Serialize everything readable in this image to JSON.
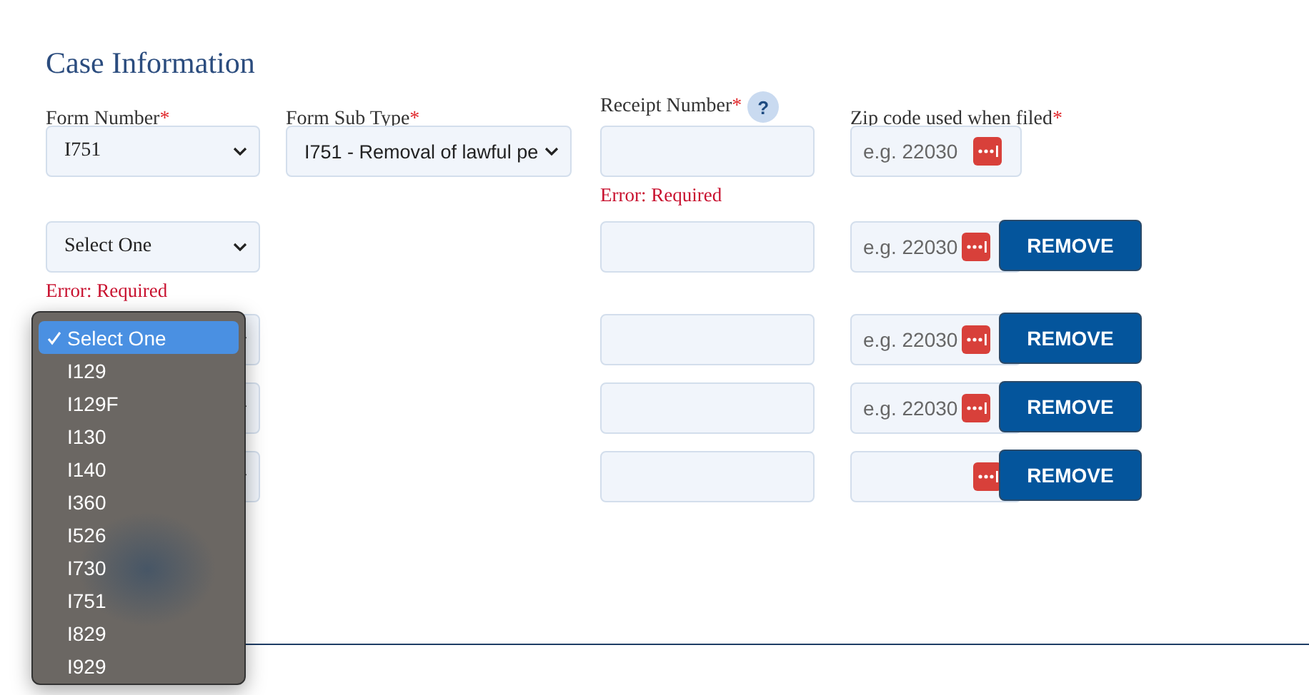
{
  "section_title": "Case Information",
  "columns": [
    {
      "label": "Form Number",
      "mark": "*"
    },
    {
      "label": "Form Sub Type",
      "mark": "*"
    },
    {
      "label": "Receipt Number",
      "mark": "*",
      "help": "?"
    },
    {
      "label": "Zip code used when filed",
      "mark": "*"
    }
  ],
  "rows": [
    {
      "form_number": {
        "value": "I751"
      },
      "sub_type": {
        "value": "I751 - Removal of lawful pe"
      },
      "receipt": {
        "error": "Error: Required"
      },
      "zip": {
        "placeholder": "e.g. 22030"
      }
    },
    {
      "form_number": {
        "value": "Select One",
        "error": "Error: Required"
      },
      "receipt": {},
      "zip": {
        "placeholder": "e.g. 22030"
      },
      "remove": "REMOVE"
    },
    {
      "form_number": {},
      "receipt": {},
      "zip": {
        "placeholder": "e.g. 22030"
      },
      "remove": "REMOVE"
    },
    {
      "form_number": {},
      "receipt": {},
      "zip": {
        "placeholder": "e.g. 22030"
      },
      "remove": "REMOVE"
    },
    {
      "form_number": {},
      "receipt": {},
      "zip": {},
      "remove": "REMOVE"
    }
  ],
  "dropdown": {
    "options": [
      {
        "label": "Select One",
        "selected": true
      },
      {
        "label": "I129",
        "selected": false
      },
      {
        "label": "I129F",
        "selected": false
      },
      {
        "label": "I130",
        "selected": false
      },
      {
        "label": "I140",
        "selected": false
      },
      {
        "label": "I360",
        "selected": false
      },
      {
        "label": "I526",
        "selected": false
      },
      {
        "label": "I730",
        "selected": false
      },
      {
        "label": "I751",
        "selected": false
      },
      {
        "label": "I829",
        "selected": false
      },
      {
        "label": "I929",
        "selected": false
      }
    ]
  }
}
